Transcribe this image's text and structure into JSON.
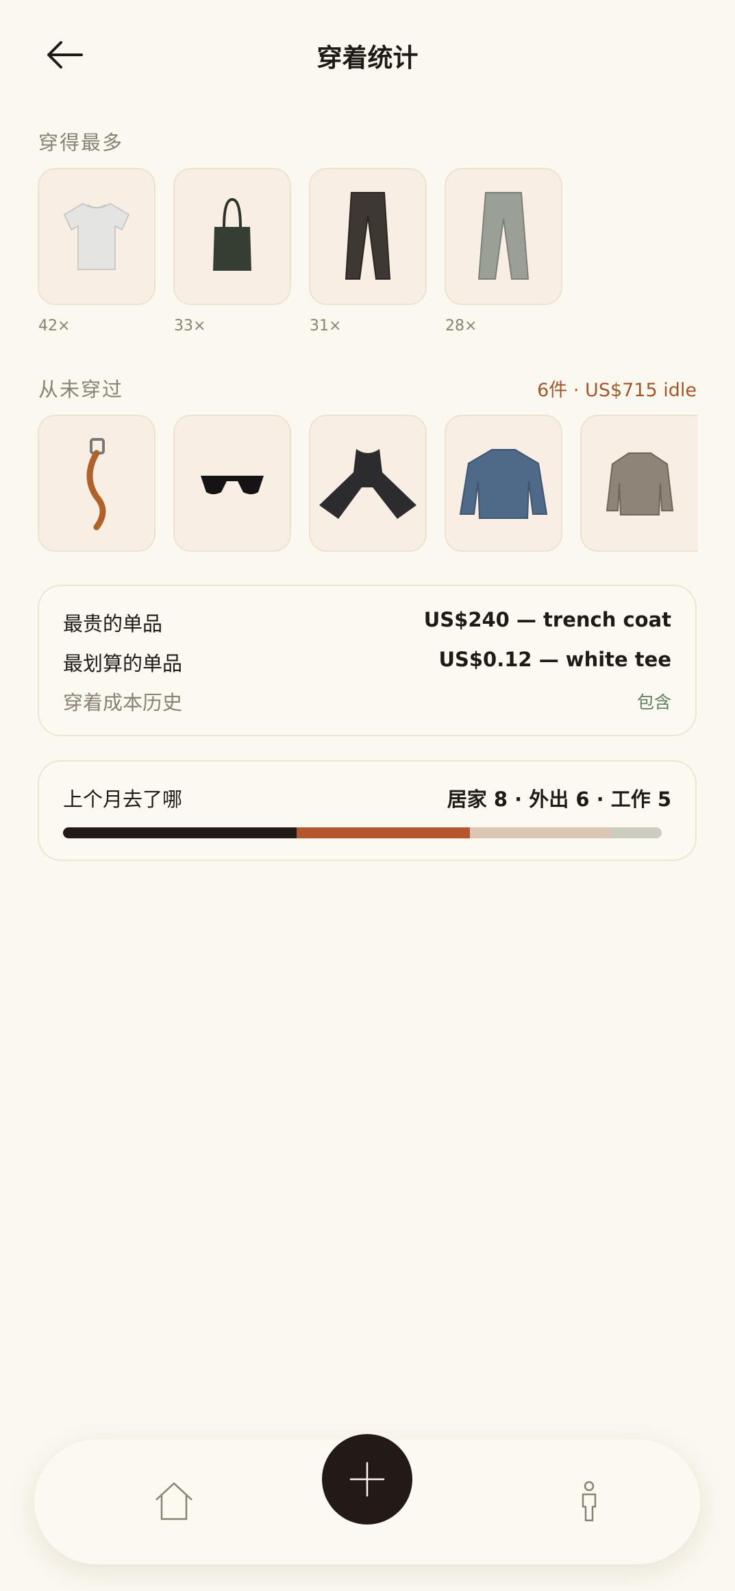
{
  "header": {
    "title": "穿着统计",
    "back_icon": "arrow-left-icon"
  },
  "most_worn": {
    "label": "穿得最多",
    "items": [
      {
        "name": "white tee",
        "count": "42×"
      },
      {
        "name": "tote bag",
        "count": "33×"
      },
      {
        "name": "trousers",
        "count": "31×"
      },
      {
        "name": "jeans",
        "count": "28×"
      }
    ]
  },
  "never_worn": {
    "label": "从未穿过",
    "summary": "6件 · US$715 idle",
    "items": [
      {
        "name": "belt"
      },
      {
        "name": "sunglasses"
      },
      {
        "name": "scarf"
      },
      {
        "name": "denim jacket"
      },
      {
        "name": "blazer"
      }
    ]
  },
  "value_card": {
    "rows": [
      {
        "label": "最贵的单品",
        "value": "US$240 — trench coat"
      },
      {
        "label": "最划算的单品",
        "value": "US$0.12 — white tee"
      }
    ],
    "history_label": "穿着成本历史",
    "history_link": "包含"
  },
  "location_card": {
    "label": "上个月去了哪",
    "summary": "居家 8 · 外出 6 · 工作 5",
    "segments": [
      {
        "name": "居家",
        "fraction": 0.39,
        "color": "#221a17"
      },
      {
        "name": "外出",
        "fraction": 0.29,
        "color": "#b5552f"
      },
      {
        "name": "工作",
        "fraction": 0.235,
        "color": "#dcc6b4"
      },
      {
        "name": "other",
        "fraction": 0.085,
        "color": "#cccdbe"
      }
    ]
  },
  "nav": {
    "home_icon": "home-icon",
    "add_icon": "plus-icon",
    "profile_icon": "person-icon"
  },
  "colors": {
    "background": "#fbf8f0",
    "accent": "#a4552c",
    "link": "#5f7d62",
    "dark": "#231a17"
  }
}
